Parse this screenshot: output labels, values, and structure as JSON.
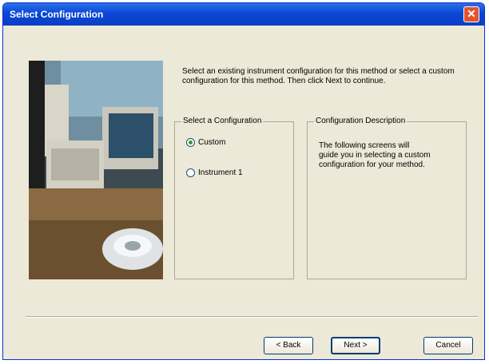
{
  "window": {
    "title": "Select Configuration"
  },
  "intro_text": "Select an existing instrument configuration for this method or select a custom configuration for this method. Then click Next to continue.",
  "configuration_group": {
    "legend": "Select a Configuration",
    "options": [
      {
        "label": "Custom",
        "selected": true
      },
      {
        "label": "Instrument 1",
        "selected": false
      }
    ]
  },
  "description_group": {
    "legend": "Configuration Description",
    "text": "The following screens will guide you in selecting a custom configuration for your method."
  },
  "buttons": {
    "back": "< Back",
    "next": "Next >",
    "cancel": "Cancel"
  },
  "colors": {
    "titlebar": "#0a47d6",
    "dialog_bg": "#ece9d8",
    "close": "#e2522d"
  },
  "icons": {
    "close": "close-icon"
  }
}
